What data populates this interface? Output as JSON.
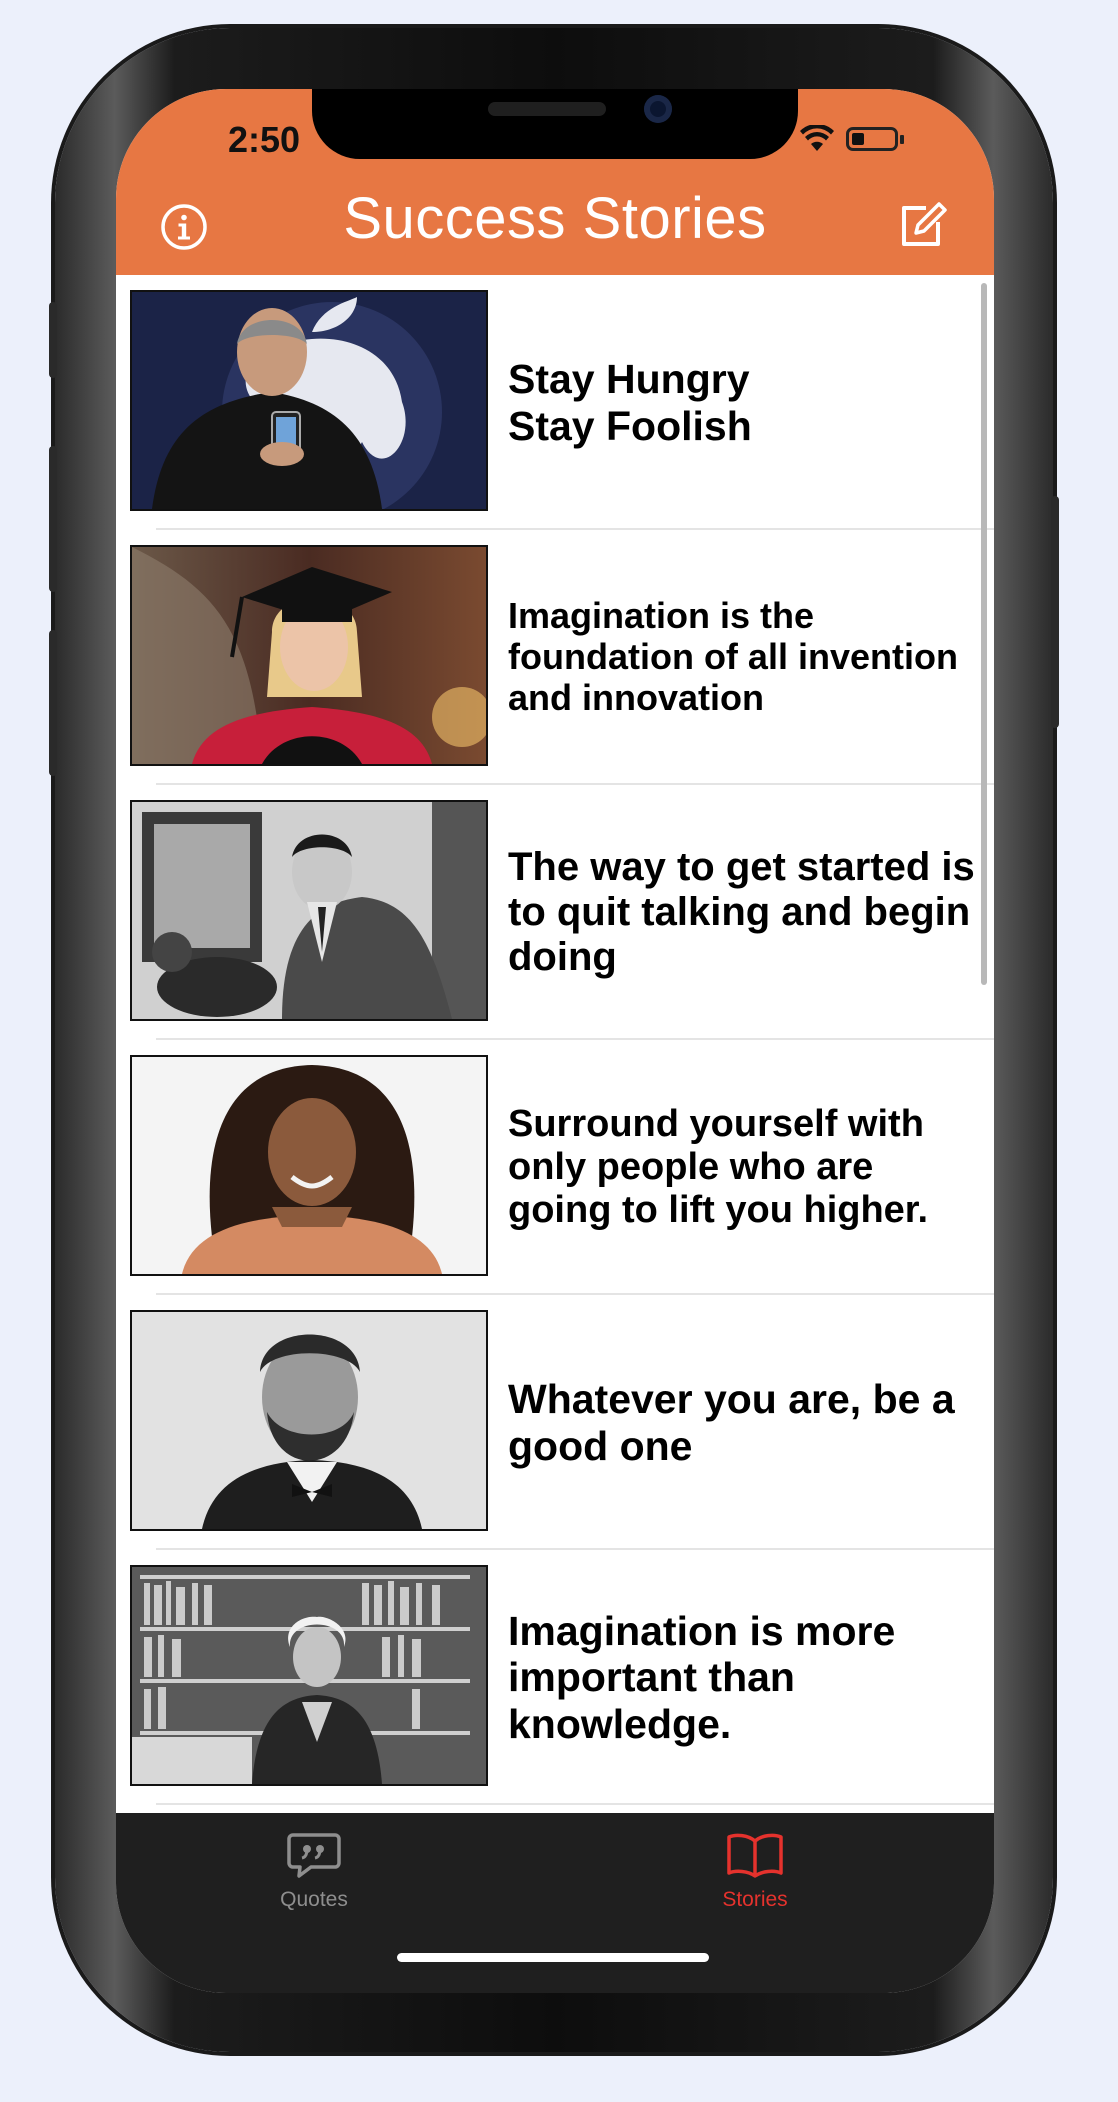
{
  "status_bar": {
    "time": "2:50"
  },
  "header": {
    "title": "Success Stories",
    "info_icon": "info-icon",
    "compose_icon": "compose-icon"
  },
  "stories": [
    {
      "quote": "Stay Hungry Stay Foolish",
      "image": "portrait-man-apple-stage"
    },
    {
      "quote": "Imagination is the foundation of all invention and innovation",
      "image": "portrait-woman-graduation"
    },
    {
      "quote": "The way to get started is to quit talking and begin doing",
      "image": "portrait-man-office-bw"
    },
    {
      "quote": "Surround yourself with only people who are going to lift you higher.",
      "image": "portrait-woman-curly-hair"
    },
    {
      "quote": "Whatever you are, be a good one",
      "image": "portrait-bearded-man-bw"
    },
    {
      "quote": "Imagination is more important than knowledge.",
      "image": "portrait-man-bookshelf-bw"
    }
  ],
  "tab_bar": {
    "tabs": [
      {
        "label": "Quotes",
        "icon": "quote-bubble-icon",
        "selected": false
      },
      {
        "label": "Stories",
        "icon": "book-icon",
        "selected": true
      }
    ]
  },
  "colors": {
    "header": "#e77743",
    "tab_bar": "#1f1f1f",
    "tab_selected": "#e5322d",
    "tab_unselected": "#8e8e8e"
  }
}
